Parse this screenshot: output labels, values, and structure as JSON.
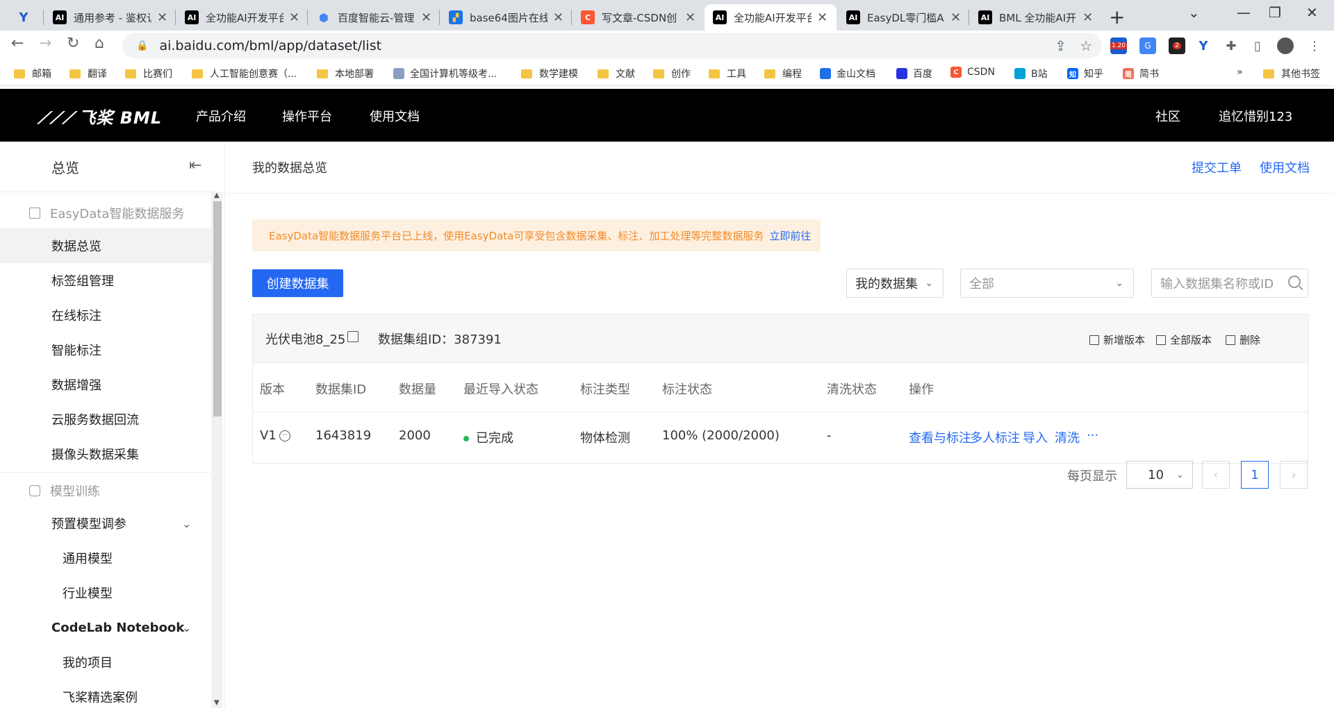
{
  "browser": {
    "tabs": [
      {
        "title": "",
        "icon": "Y",
        "icon_color": "#1a5ccf",
        "icon_text_color": "#ffffff"
      },
      {
        "title": "通用参考 - 鉴权认",
        "icon": "AI",
        "icon_color": "#000000",
        "icon_text_color": "#ffffff"
      },
      {
        "title": "全功能AI开发平台",
        "icon": "AI",
        "icon_color": "#000000",
        "icon_text_color": "#ffffff"
      },
      {
        "title": "百度智能云-管理",
        "icon": "◆",
        "icon_color": "#ffffff",
        "icon_text_color": "#4285f4"
      },
      {
        "title": "base64图片在线",
        "icon": "▣",
        "icon_color": "#ffffff",
        "icon_text_color": "#1a73e8"
      },
      {
        "title": "写文章-CSDN创",
        "icon": "C",
        "icon_color": "#fc5531",
        "icon_text_color": "#ffffff"
      },
      {
        "title": "全功能AI开发平台",
        "icon": "AI",
        "icon_color": "#000000",
        "icon_text_color": "#ffffff"
      },
      {
        "title": "EasyDL零门槛AI",
        "icon": "AI",
        "icon_color": "#000000",
        "icon_text_color": "#ffffff"
      },
      {
        "title": "BML 全功能AI开",
        "icon": "AI",
        "icon_color": "#000000",
        "icon_text_color": "#ffffff"
      }
    ],
    "url": "ai.baidu.com/bml/app/dataset/list",
    "extension_badge_1": "1.20",
    "extension_badge_2": "2",
    "bookmarks": [
      {
        "label": "邮箱",
        "type": "folder"
      },
      {
        "label": "翻译",
        "type": "folder"
      },
      {
        "label": "比赛们",
        "type": "folder"
      },
      {
        "label": "人工智能创意赛（...",
        "type": "folder"
      },
      {
        "label": "本地部署",
        "type": "folder"
      },
      {
        "label": "全国计算机等级考...",
        "type": "site"
      },
      {
        "label": "数学建模",
        "type": "folder"
      },
      {
        "label": "文献",
        "type": "folder"
      },
      {
        "label": "创作",
        "type": "folder"
      },
      {
        "label": "工具",
        "type": "folder"
      },
      {
        "label": "编程",
        "type": "folder"
      },
      {
        "label": "金山文档",
        "type": "site"
      },
      {
        "label": "百度",
        "type": "site"
      },
      {
        "label": "CSDN",
        "type": "site"
      },
      {
        "label": "B站",
        "type": "site"
      },
      {
        "label": "知乎",
        "type": "site"
      },
      {
        "label": "简书",
        "type": "site"
      }
    ],
    "bookmarks_more": "»",
    "other_bookmarks": "其他书签"
  },
  "header": {
    "logo": "飞桨 BML",
    "logo_mark": "⼴⼴",
    "nav": [
      "产品介绍",
      "操作平台",
      "使用文档"
    ],
    "community": "社区",
    "username": "追忆惜别123"
  },
  "sidebar": {
    "overview": "总览",
    "group_easydata": "EasyData智能数据服务",
    "easydata_items": [
      "数据总览",
      "标签组管理",
      "在线标注",
      "智能标注",
      "数据增强",
      "云服务数据回流",
      "摄像头数据采集"
    ],
    "group_training": "模型训练",
    "preset_tuning": "预置模型调参",
    "preset_sub": [
      "通用模型",
      "行业模型"
    ],
    "codelab": "CodeLab Notebook",
    "codelab_sub": [
      "我的项目",
      "飞桨精选案例"
    ]
  },
  "main": {
    "title": "我的数据总览",
    "link_ticket": "提交工单",
    "link_docs": "使用文档",
    "notice": "EasyData智能数据服务平台已上线，使用EasyData可享受包含数据采集、标注、加工处理等完整数据服务",
    "notice_link": "立即前往",
    "create_button": "创建数据集",
    "filter_scope": "我的数据集",
    "filter_type": "全部",
    "search_placeholder": "输入数据集名称或ID",
    "dataset": {
      "name": "光伏电池8_25",
      "group_id_label": "数据集组ID：387391",
      "action_add": "新增版本",
      "action_all": "全部版本",
      "action_delete": "删除",
      "columns": [
        "版本",
        "数据集ID",
        "数据量",
        "最近导入状态",
        "标注类型",
        "标注状态",
        "清洗状态",
        "操作"
      ],
      "row": {
        "version": "V1",
        "id": "1643819",
        "count": "2000",
        "import_status": "已完成",
        "label_type": "物体检测",
        "label_status": "100% (2000/2000)",
        "clean_status": "-",
        "ops": [
          "查看与标注",
          "多人标注",
          "导入",
          "清洗",
          "···"
        ]
      }
    },
    "pagination": {
      "per_page_label": "每页显示",
      "per_page": "10",
      "current_page": "1",
      "prev": "‹",
      "next": "›"
    }
  },
  "colors": {
    "primary": "#2468f2",
    "notice_bg": "#fdf0e1",
    "notice_text": "#f28c28",
    "success": "#27b95c",
    "header_bg": "#000000"
  }
}
